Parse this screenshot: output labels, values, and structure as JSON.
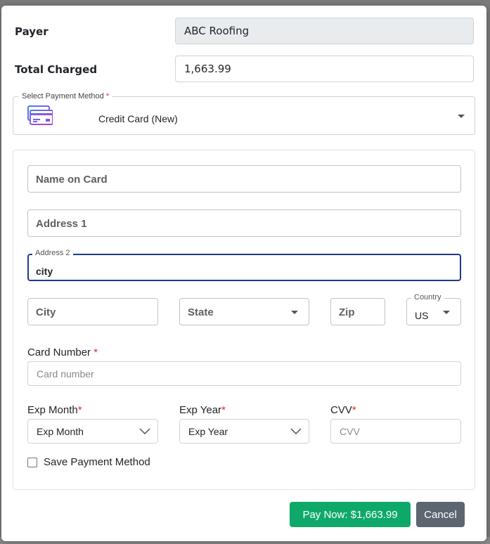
{
  "payer": {
    "label": "Payer",
    "value": "ABC Roofing"
  },
  "total": {
    "label": "Total Charged",
    "value": "1,663.99"
  },
  "payment_method": {
    "legend": "Select Payment Method",
    "required_mark": "*",
    "selected": "Credit Card (New)",
    "icon": "credit-card-icon"
  },
  "card_form": {
    "name_on_card": {
      "placeholder": "Name on Card"
    },
    "address1": {
      "placeholder": "Address 1"
    },
    "address2": {
      "label": "Address 2",
      "value": "city"
    },
    "city": {
      "placeholder": "City"
    },
    "state": {
      "placeholder": "State"
    },
    "zip": {
      "placeholder": "Zip"
    },
    "country": {
      "label": "Country",
      "value": "US"
    },
    "card_number": {
      "label": "Card Number",
      "required_mark": "*",
      "placeholder": "Card number"
    },
    "exp_month": {
      "label": "Exp Month",
      "required_mark": "*",
      "selected": "Exp Month"
    },
    "exp_year": {
      "label": "Exp Year",
      "required_mark": "*",
      "selected": "Exp Year"
    },
    "cvv": {
      "label": "CVV",
      "required_mark": "*",
      "placeholder": "CVV"
    },
    "save_method": {
      "label": "Save Payment Method",
      "checked": false
    }
  },
  "actions": {
    "pay_label": "Pay Now: $1,663.99",
    "cancel_label": "Cancel"
  },
  "colors": {
    "pay": "#0ea96a",
    "cancel": "#5c6570",
    "focus": "#1e3a8a",
    "required": "#d32f2f"
  }
}
